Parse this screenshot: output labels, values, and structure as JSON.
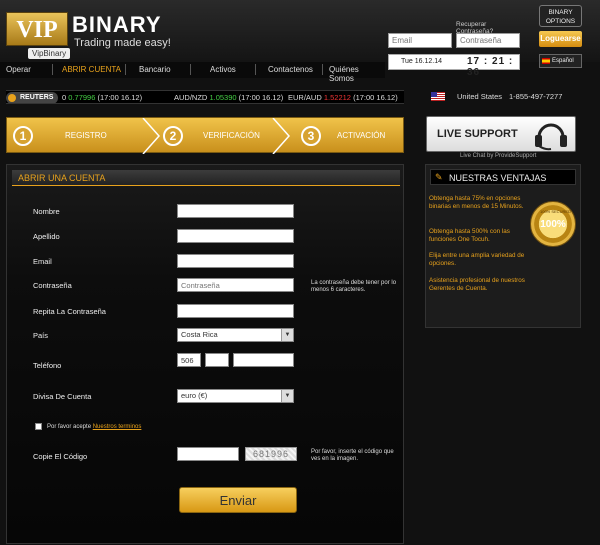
{
  "header": {
    "logo_vip": "VIP",
    "logo_binary": "BINARY",
    "tagline": "Trading made easy!",
    "logo_sub": "VipBinary",
    "options_label": "BINARY OPTIONS",
    "recover_label": "Recuperar Contraseña?",
    "email_placeholder": "Email",
    "password_placeholder": "Contraseña",
    "login_label": "Loguearse",
    "date": "Tue 16.12.14",
    "time": "17 : 21 : 36",
    "language": "Español"
  },
  "nav": [
    {
      "label": "Operar",
      "active": false
    },
    {
      "label": "ABRIR CUENTA",
      "active": true
    },
    {
      "label": "Bancario",
      "active": false
    },
    {
      "label": "Activos",
      "active": false
    },
    {
      "label": "Contactenos",
      "active": false
    },
    {
      "label": "Quiénes Somos",
      "active": false
    }
  ],
  "ticker": {
    "brand": "REUTERS",
    "items": [
      {
        "prefix": "0",
        "value": "0.77996",
        "time": "(17:00 16.12)",
        "dir": "up"
      },
      {
        "pair": "AUD/NZD",
        "value": "1.05390",
        "time": "(17:00 16.12)",
        "dir": "up"
      },
      {
        "pair": "EUR/AUD",
        "value": "1.52212",
        "time": "(17:00 16.12)",
        "dir": "down"
      }
    ]
  },
  "contact": {
    "country": "United States",
    "phone": "1-855-497-7277"
  },
  "steps": [
    {
      "num": "1",
      "label": "REGISTRO"
    },
    {
      "num": "2",
      "label": "VERIFICACIÓN"
    },
    {
      "num": "3",
      "label": "ACTIVACIÓN"
    }
  ],
  "support": {
    "label": "LIVE SUPPORT",
    "livechat": "Live Chat by ProvideSupport"
  },
  "form": {
    "title": "ABRIR UNA CUENTA",
    "labels": {
      "nombre": "Nombre",
      "apellido": "Apellido",
      "email": "Email",
      "password": "Contraseña",
      "repeat": "Repita La Contraseña",
      "pais": "País",
      "telefono": "Teléfono",
      "divisa": "Divisa De Cuenta",
      "codigo": "Copie El Código"
    },
    "password_placeholder": "Contraseña",
    "password_note": "La contraseña debe tener por lo menos 6 caracteres.",
    "country_value": "Costa Rica",
    "phone_code": "506",
    "currency_value": "euro  (€)",
    "terms_text": "Por favor acepte",
    "terms_link": "Nuestros terminos",
    "captcha_value": "681996",
    "captcha_note": "Por favor, inserte el código que ves en la imagen.",
    "submit_label": "Enviar"
  },
  "ventajas": {
    "title": "NUESTRAS VENTAJAS",
    "items": [
      "Obtenga hasta 75% en opciones binarias en menos de 15 Minutos.",
      "Obtenga hasta 500% con las funciones One Tocuh.",
      "Elija entre una amplia variedad de opciones.",
      "Asistencia profesional de nuestros Gerentes de Cuenta."
    ],
    "badge": "100%",
    "badge_small": "100% SECURED"
  },
  "colors": {
    "accent": "#e8a21c",
    "up": "#44cc44",
    "down": "#ee3333"
  }
}
